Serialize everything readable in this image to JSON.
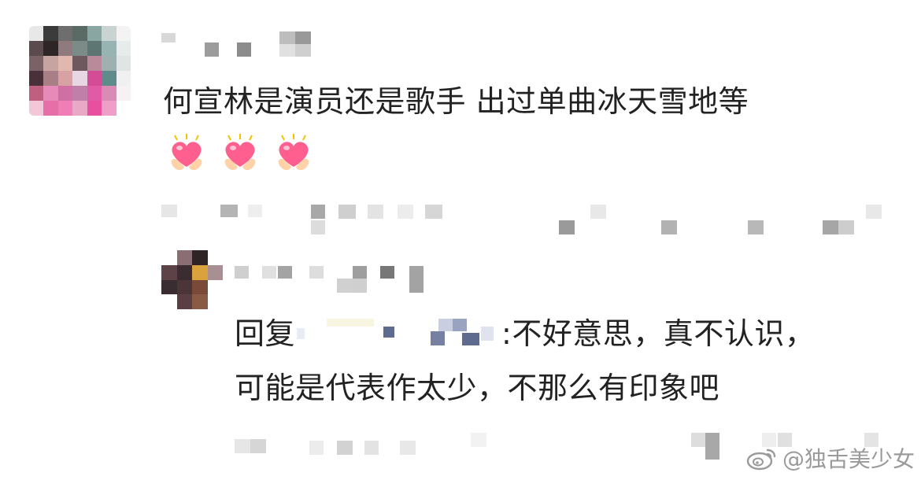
{
  "comment": {
    "author_blurred": true,
    "text": "何宣林是演员还是歌手 出过单曲冰天雪地等",
    "emoji": [
      "heart-hands-emoji",
      "heart-hands-emoji",
      "heart-hands-emoji"
    ]
  },
  "reply": {
    "prefix": "回复",
    "mention_blurred": true,
    "text_line1": ":不好意思，真不认识，",
    "text_line2": "可能是代表作太少，不那么有印象吧"
  },
  "watermark": {
    "icon": "weibo-logo",
    "text": "@独舌美少女"
  },
  "colors": {
    "text": "#222222",
    "heart": "#ff5f8f",
    "hands": "#ffd2a8",
    "watermark": "#8a8a8a"
  }
}
